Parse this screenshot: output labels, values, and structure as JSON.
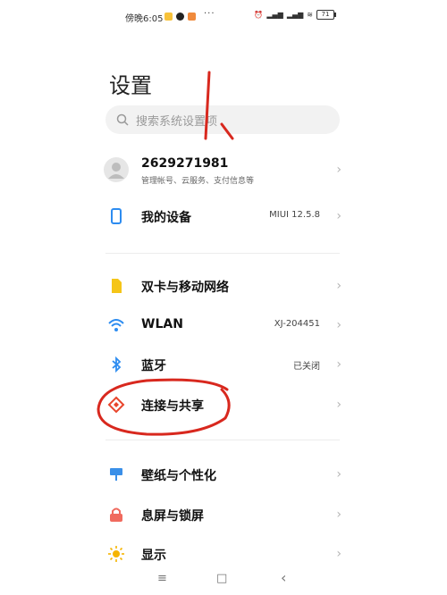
{
  "status_bar": {
    "time": "傍晚6:05",
    "more": "···",
    "battery": "71"
  },
  "page_title": "设置",
  "search": {
    "placeholder": "搜索系统设置项"
  },
  "account": {
    "name": "2629271981",
    "subtitle": "管理帐号、云服务、支付信息等"
  },
  "items": [
    {
      "label": "我的设备",
      "value": "MIUI 12.5.8",
      "icon": "device-icon"
    },
    {
      "label": "双卡与移动网络",
      "value": "",
      "icon": "sim-card-icon"
    },
    {
      "label": "WLAN",
      "value": "XJ-204451",
      "icon": "wifi-icon"
    },
    {
      "label": "蓝牙",
      "value": "已关闭",
      "icon": "bluetooth-icon"
    },
    {
      "label": "连接与共享",
      "value": "",
      "icon": "share-icon"
    },
    {
      "label": "壁纸与个性化",
      "value": "",
      "icon": "wallpaper-icon"
    },
    {
      "label": "息屏与锁屏",
      "value": "",
      "icon": "lock-icon"
    },
    {
      "label": "显示",
      "value": "",
      "icon": "brightness-icon"
    }
  ],
  "nav": {
    "menu": "≡",
    "home": "□",
    "back": "‹"
  },
  "annotation": {
    "handwritten": "1."
  },
  "colors": {
    "accent_blue": "#2d8cf0",
    "sim_yellow": "#f5c518",
    "share_red": "#e8452c",
    "wallpaper_blue": "#3a8fe8",
    "lock_red": "#f06a5e",
    "brightness_yellow": "#f5b400",
    "ink_red": "#d8281e"
  }
}
